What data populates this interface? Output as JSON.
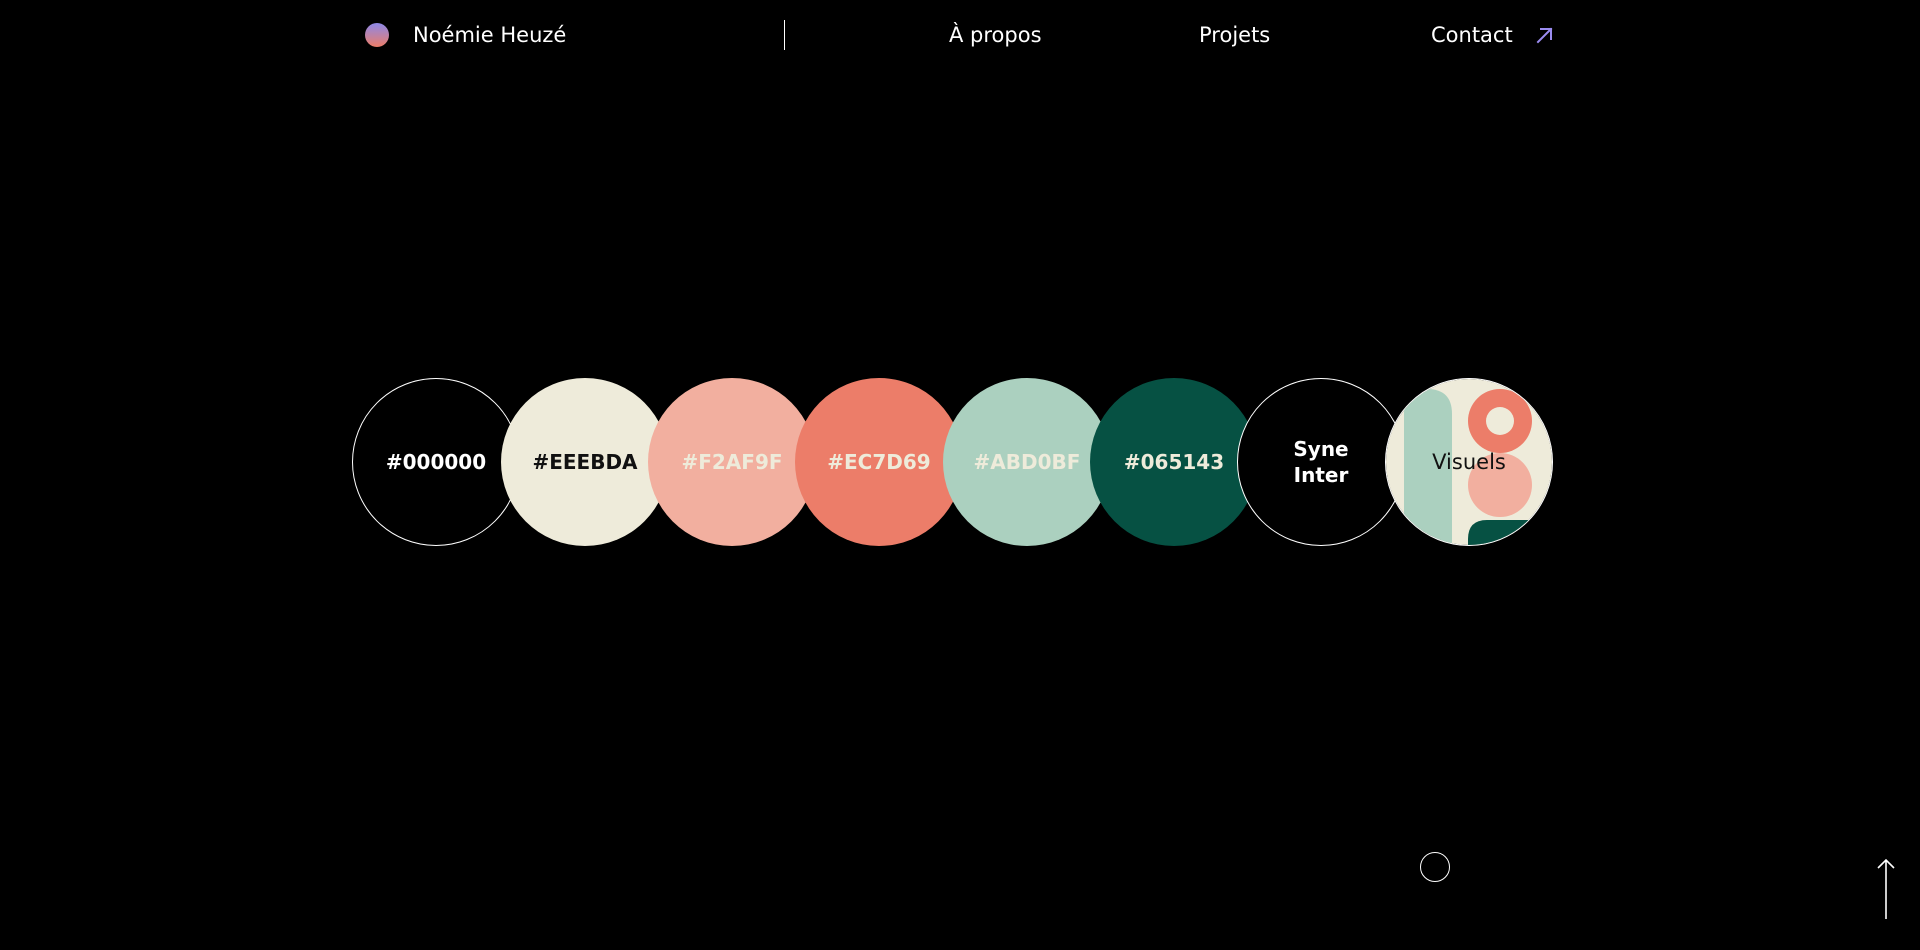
{
  "header": {
    "site_name": "Noémie Heuzé",
    "nav": {
      "about": "À propos",
      "projects": "Projets",
      "contact": "Contact"
    }
  },
  "palette": [
    {
      "label": "#000000",
      "color": "#000000"
    },
    {
      "label": "#EEEBDA",
      "color": "#EEEBDA"
    },
    {
      "label": "#F2AF9F",
      "color": "#F2AF9F"
    },
    {
      "label": "#EC7D69",
      "color": "#EC7D69"
    },
    {
      "label": "#ABD0BF",
      "color": "#ABD0BF"
    },
    {
      "label": "#065143",
      "color": "#065143"
    }
  ],
  "fonts": {
    "line1": "Syne",
    "line2": "Inter"
  },
  "visuels": {
    "label": "Visuels"
  },
  "colors": {
    "background": "#000000",
    "accent_arrow": "#9b8cf0"
  },
  "icons": {
    "logo": "gradient-dot-icon",
    "contact": "arrow-up-right-icon",
    "scroll": "circle-outline-icon",
    "back_to_top": "arrow-up-icon"
  }
}
